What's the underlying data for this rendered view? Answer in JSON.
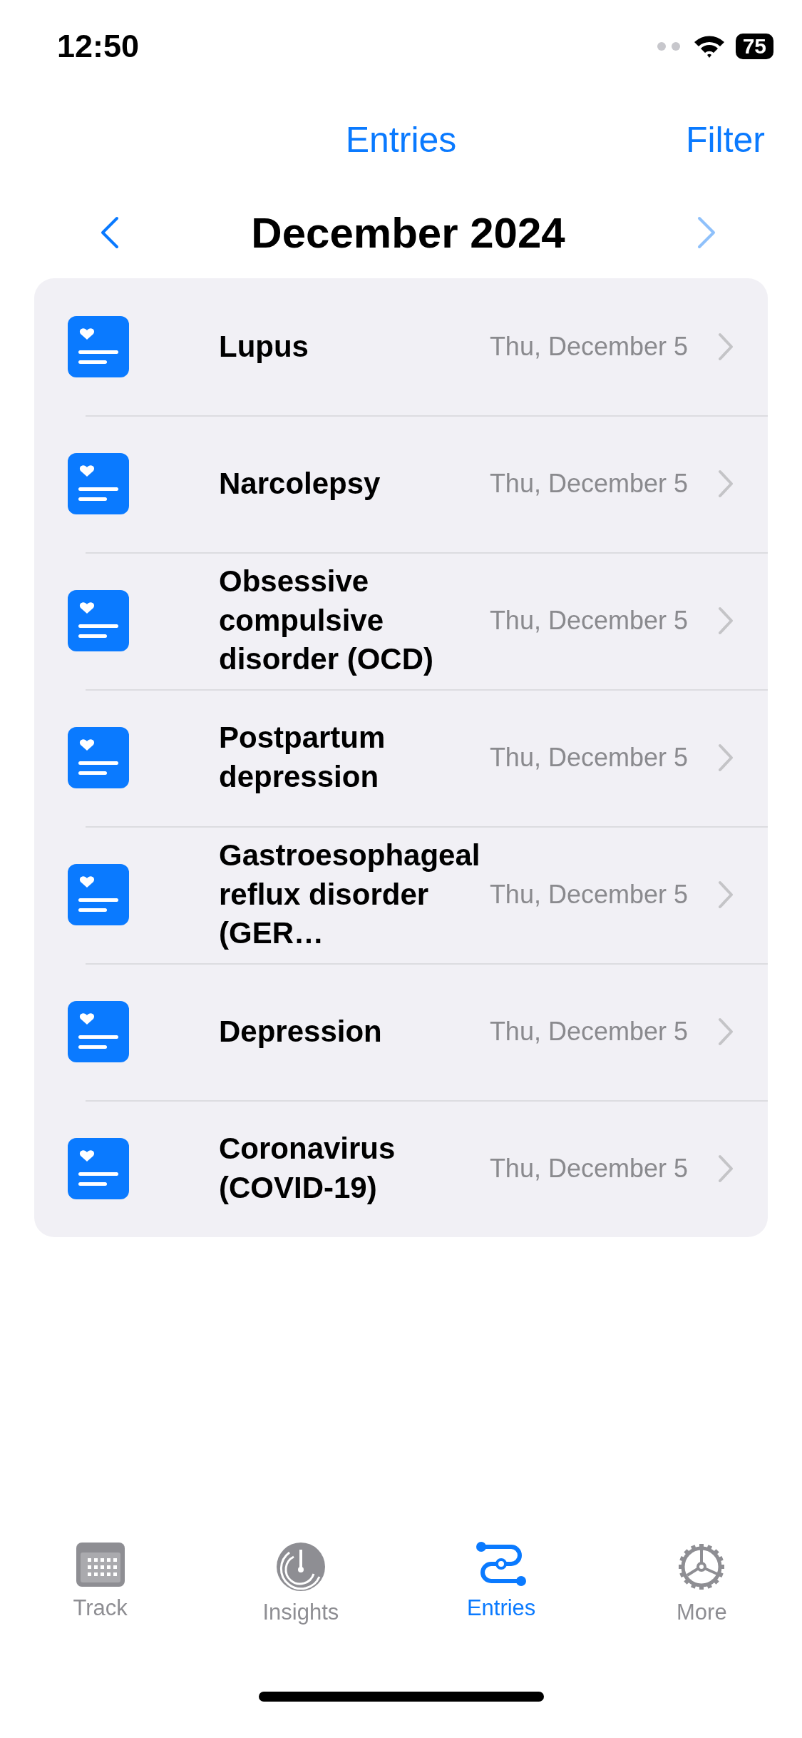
{
  "status_bar": {
    "time": "12:50",
    "battery": "75"
  },
  "nav": {
    "title": "Entries",
    "action": "Filter"
  },
  "month": {
    "title": "December 2024",
    "prev_enabled": true,
    "next_enabled": false
  },
  "entries": [
    {
      "title": "Lupus",
      "date": "Thu, December 5"
    },
    {
      "title": "Narcolepsy",
      "date": "Thu, December 5"
    },
    {
      "title": "Obsessive compulsive disorder (OCD)",
      "date": "Thu, December 5"
    },
    {
      "title": "Postpartum depression",
      "date": "Thu, December 5"
    },
    {
      "title": "Gastroesophageal reflux disorder (GER…",
      "date": "Thu, December 5"
    },
    {
      "title": "Depression",
      "date": "Thu, December 5"
    },
    {
      "title": "Coronavirus (COVID-19)",
      "date": "Thu, December 5"
    }
  ],
  "tabs": [
    {
      "kind": "track",
      "label": "Track",
      "selected": false
    },
    {
      "kind": "insights",
      "label": "Insights",
      "selected": false
    },
    {
      "kind": "entries",
      "label": "Entries",
      "selected": true
    },
    {
      "kind": "more",
      "label": "More",
      "selected": false
    }
  ]
}
